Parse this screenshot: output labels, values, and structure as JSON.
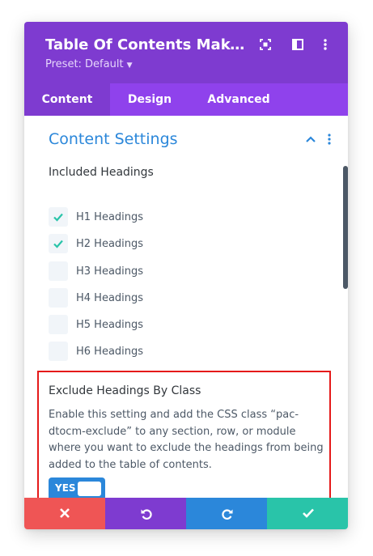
{
  "header": {
    "title": "Table Of Contents Maker Settings",
    "preset_label": "Preset: Default",
    "icons": [
      "fullscreen-icon",
      "sidebar-icon",
      "more-vertical-icon"
    ]
  },
  "tabs": [
    {
      "label": "Content",
      "active": true
    },
    {
      "label": "Design",
      "active": false
    },
    {
      "label": "Advanced",
      "active": false
    }
  ],
  "section": {
    "title": "Content Settings",
    "icons": [
      "chevron-up-icon",
      "more-vertical-icon"
    ]
  },
  "included_headings": {
    "label": "Included Headings",
    "items": [
      {
        "label": "H1 Headings",
        "checked": true
      },
      {
        "label": "H2 Headings",
        "checked": true
      },
      {
        "label": "H3 Headings",
        "checked": false
      },
      {
        "label": "H4 Headings",
        "checked": false
      },
      {
        "label": "H5 Headings",
        "checked": false
      },
      {
        "label": "H6 Headings",
        "checked": false
      }
    ]
  },
  "exclude": {
    "title": "Exclude Headings By Class",
    "description": "Enable this setting and add the CSS class “pac-dtocm-exclude” to any section, row, or module where you want to exclude the headings from being added to the table of contents.",
    "toggle_label": "YES",
    "toggle_on": true
  },
  "footer": {
    "buttons": [
      {
        "name": "cancel",
        "icon": "close-icon",
        "color": "#ef5555"
      },
      {
        "name": "undo",
        "icon": "undo-icon",
        "color": "#7e3bd0"
      },
      {
        "name": "redo",
        "icon": "redo-icon",
        "color": "#2b87da"
      },
      {
        "name": "save",
        "icon": "check-icon",
        "color": "#29c4a9"
      }
    ]
  },
  "colors": {
    "header_purple": "#7e3bd0",
    "tab_purple": "#8f42ec",
    "accent_blue": "#2b87da",
    "check_teal": "#29c4a9",
    "highlight_red": "#e51a1a"
  }
}
